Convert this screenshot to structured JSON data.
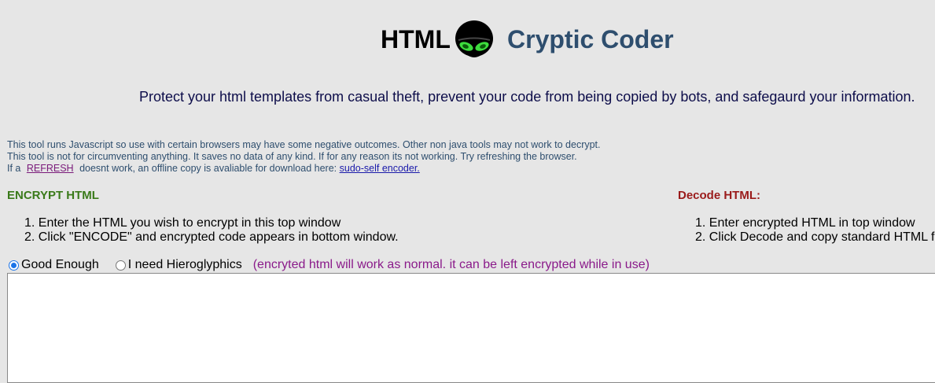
{
  "header": {
    "title_left": "HTML",
    "title_right": "Cryptic Coder",
    "tagline": "Protect your html templates from casual theft, prevent your code from being copied by bots, and safegaurd your information."
  },
  "notes": {
    "line1": "This tool runs Javascript so use with certain browsers may have some negative outcomes. Other non java tools may not work to decrypt.",
    "line2": "This tool is not for circumventing anything. It saves no data of any kind. If for any reason its not working. Try refreshing the browser.",
    "line3_prefix": "If a",
    "refresh_link": "REFRESH",
    "line3_middle": " doesnt work, an offline copy is avaliable for download here:",
    "download_link": "sudo-self encoder."
  },
  "encrypt": {
    "heading": "ENCRYPT HTML",
    "steps": [
      "1. Enter the HTML you wish to encrypt in this top window",
      "2. Click \"ENCODE\" and encrypted code appears in bottom window."
    ]
  },
  "decode": {
    "heading": "Decode HTML:",
    "steps": [
      "1. Enter encrypted HTML in top window",
      "2. Click Decode and copy standard HTML f"
    ]
  },
  "options": {
    "radio1_label": "Good Enough",
    "radio2_label": "I need Hieroglyphics",
    "selected": "Good Enough",
    "note": "(encryted html will work as normal. it can be left encrypted while in use)"
  },
  "input": {
    "value": ""
  }
}
